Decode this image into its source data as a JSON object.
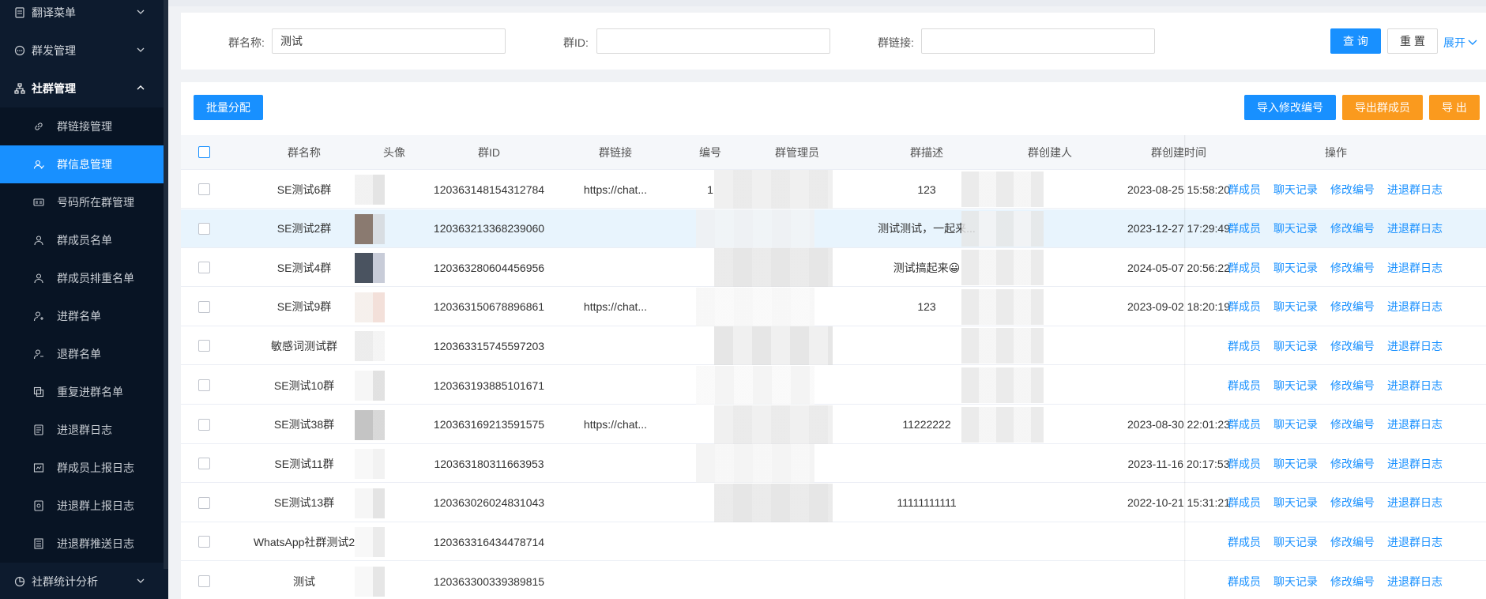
{
  "sidebar": {
    "items": [
      {
        "label": "翻译菜单",
        "icon": "doc-icon",
        "expanded": false
      },
      {
        "label": "群发管理",
        "icon": "chat-icon",
        "expanded": false
      },
      {
        "label": "社群管理",
        "icon": "org-icon",
        "expanded": true
      },
      {
        "label": "社群统计分析",
        "icon": "pie-icon",
        "expanded": false
      }
    ],
    "sub_items": [
      {
        "label": "群链接管理",
        "icon": "link-icon"
      },
      {
        "label": "群信息管理",
        "icon": "people-icon",
        "active": true
      },
      {
        "label": "号码所在群管理",
        "icon": "card-icon"
      },
      {
        "label": "群成员名单",
        "icon": "user-icon"
      },
      {
        "label": "群成员排重名单",
        "icon": "user-icon"
      },
      {
        "label": "进群名单",
        "icon": "user-in-icon"
      },
      {
        "label": "退群名单",
        "icon": "user-out-icon"
      },
      {
        "label": "重复进群名单",
        "icon": "copy-icon"
      },
      {
        "label": "进退群日志",
        "icon": "log-icon"
      },
      {
        "label": "群成员上报日志",
        "icon": "report-icon"
      },
      {
        "label": "进退群上报日志",
        "icon": "report-icon"
      },
      {
        "label": "进退群推送日志",
        "icon": "list-icon"
      }
    ]
  },
  "search": {
    "group_name_label": "群名称:",
    "group_name_value": "测试",
    "group_id_label": "群ID:",
    "group_id_value": "",
    "group_link_label": "群链接:",
    "group_link_value": "",
    "query_button": "查 询",
    "reset_button": "重 置",
    "expand_link": "展开"
  },
  "toolbar": {
    "batch_assign": "批量分配",
    "import_modify": "导入修改编号",
    "export_members": "导出群成员",
    "export": "导 出"
  },
  "table": {
    "headers": [
      "群名称",
      "头像",
      "群ID",
      "群链接",
      "编号",
      "群管理员",
      "群描述",
      "群创建人",
      "群创建时间",
      "操作"
    ],
    "actions": [
      "群成员",
      "聊天记录",
      "修改编号",
      "进退群日志"
    ],
    "rows": [
      {
        "name": "SE测试6群",
        "id": "120363148154312784",
        "link": "https://chat...",
        "num": "1",
        "desc": "123",
        "time": "2023-08-25 15:58:20"
      },
      {
        "name": "SE测试2群",
        "id": "120363213368239060",
        "link": "",
        "num": "",
        "desc": "测试测试，一起来...",
        "time": "2023-12-27 17:29:49"
      },
      {
        "name": "SE测试4群",
        "id": "120363280604456956",
        "link": "",
        "num": "",
        "desc": "测试搞起来😀",
        "time": "2024-05-07 20:56:22"
      },
      {
        "name": "SE测试9群",
        "id": "120363150678896861",
        "link": "https://chat...",
        "num": "",
        "desc": "123",
        "time": "2023-09-02 18:20:19"
      },
      {
        "name": "敏感词测试群",
        "id": "120363315745597203",
        "link": "",
        "num": "",
        "desc": "",
        "time": ""
      },
      {
        "name": "SE测试10群",
        "id": "120363193885101671",
        "link": "",
        "num": "",
        "desc": "",
        "time": ""
      },
      {
        "name": "SE测试38群",
        "id": "120363169213591575",
        "link": "https://chat...",
        "num": "",
        "desc": "11222222",
        "time": "2023-08-30 22:01:23"
      },
      {
        "name": "SE测试11群",
        "id": "120363180311663953",
        "link": "",
        "num": "",
        "desc": "",
        "time": "2023-11-16 20:17:53"
      },
      {
        "name": "SE测试13群",
        "id": "120363026024831043",
        "link": "",
        "num": "",
        "desc": "11111111111",
        "time": "2022-10-21 15:31:21"
      },
      {
        "name": "WhatsApp社群测试2",
        "id": "120363316434478714",
        "link": "",
        "num": "",
        "desc": "",
        "time": ""
      },
      {
        "name": "测试",
        "id": "120363300339389815",
        "link": "",
        "num": "",
        "desc": "",
        "time": ""
      }
    ]
  },
  "colors": {
    "primary": "#1890ff",
    "orange": "#fa9a1e",
    "sidebar_bg": "#0d1b2e"
  }
}
